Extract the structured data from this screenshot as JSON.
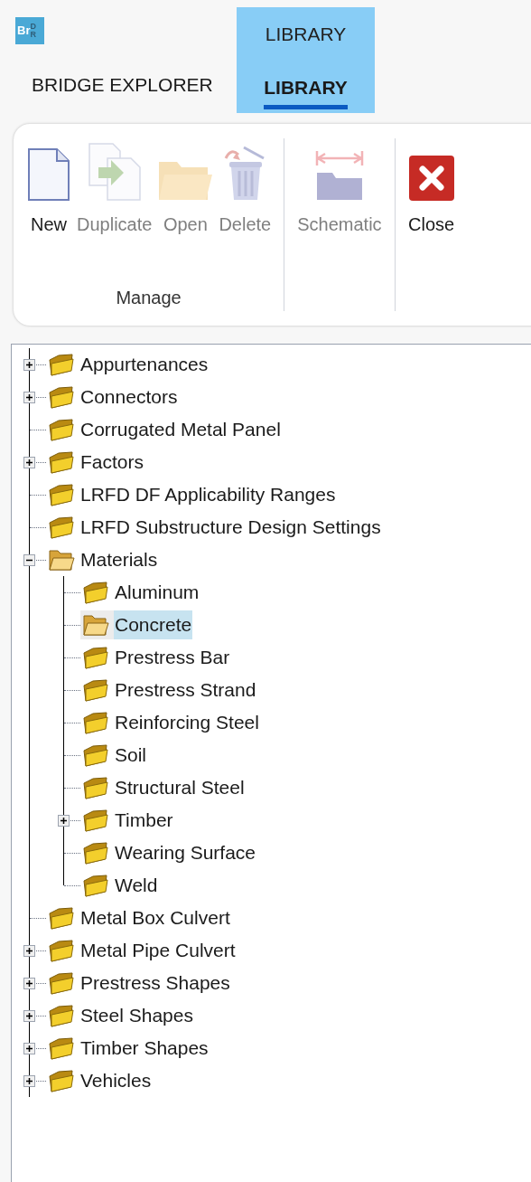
{
  "logo": {
    "main": "Br",
    "side": "DR"
  },
  "context_tab_group": {
    "label": "LIBRARY"
  },
  "tabs": [
    {
      "label": "BRIDGE EXPLORER",
      "selected": false
    },
    {
      "label": "LIBRARY",
      "selected": true
    }
  ],
  "ribbon": {
    "groups": [
      {
        "label": "Manage",
        "buttons": [
          {
            "label": "New",
            "kind": "new",
            "disabled": false
          },
          {
            "label": "Duplicate",
            "kind": "duplicate",
            "disabled": true
          },
          {
            "label": "Open",
            "kind": "open",
            "disabled": true
          },
          {
            "label": "Delete",
            "kind": "delete",
            "disabled": true
          }
        ]
      },
      {
        "buttons": [
          {
            "label": "Schematic",
            "kind": "schematic",
            "disabled": true
          }
        ]
      },
      {
        "buttons": [
          {
            "label": "Close",
            "kind": "close",
            "disabled": false
          }
        ]
      }
    ]
  },
  "tree": {
    "items": [
      {
        "label": "Appurtenances",
        "expanded": false,
        "selected": false
      },
      {
        "label": "Connectors",
        "expanded": false,
        "selected": false
      },
      {
        "label": "Corrugated Metal Panel",
        "selected": false
      },
      {
        "label": "Factors",
        "expanded": false,
        "selected": false
      },
      {
        "label": "LRFD DF Applicability Ranges",
        "selected": false
      },
      {
        "label": "LRFD Substructure Design Settings",
        "selected": false
      },
      {
        "label": "Materials",
        "expanded": true,
        "selected": false,
        "children": [
          {
            "label": "Aluminum",
            "selected": false
          },
          {
            "label": "Concrete",
            "selected": true
          },
          {
            "label": "Prestress Bar",
            "selected": false
          },
          {
            "label": "Prestress Strand",
            "selected": false
          },
          {
            "label": "Reinforcing Steel",
            "selected": false
          },
          {
            "label": "Soil",
            "selected": false
          },
          {
            "label": "Structural Steel",
            "selected": false
          },
          {
            "label": "Timber",
            "expanded": false,
            "selected": false
          },
          {
            "label": "Wearing Surface",
            "selected": false
          },
          {
            "label": "Weld",
            "selected": false
          }
        ]
      },
      {
        "label": "Metal Box Culvert",
        "selected": false
      },
      {
        "label": "Metal Pipe Culvert",
        "expanded": false,
        "selected": false
      },
      {
        "label": "Prestress Shapes",
        "expanded": false,
        "selected": false
      },
      {
        "label": "Steel Shapes",
        "expanded": false,
        "selected": false
      },
      {
        "label": "Timber Shapes",
        "expanded": false,
        "selected": false
      },
      {
        "label": "Vehicles",
        "expanded": false,
        "selected": false
      }
    ]
  }
}
